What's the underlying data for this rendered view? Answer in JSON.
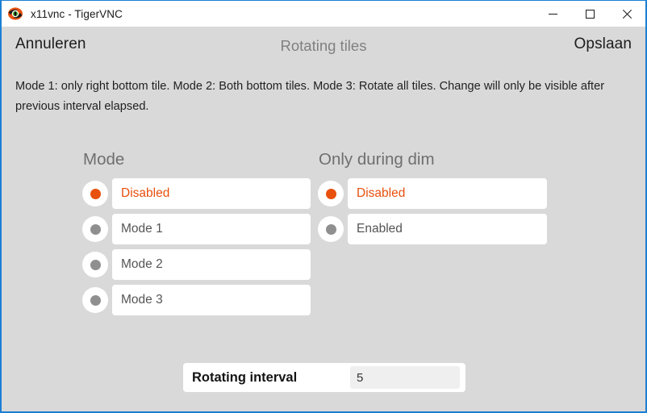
{
  "window": {
    "title": "x11vnc - TigerVNC",
    "app_icon": "tigervnc-icon",
    "border_color": "#1b7fd4",
    "background_color": "#d9d9d9",
    "controls": {
      "minimize": "minimize-icon",
      "maximize": "maximize-icon",
      "close": "close-icon"
    }
  },
  "topbar": {
    "cancel_label": "Annuleren",
    "screen_title": "Rotating tiles",
    "save_label": "Opslaan"
  },
  "description": "Mode 1: only right bottom tile. Mode 2: Both bottom tiles. Mode 3: Rotate all tiles. Change will only be visible after previous interval elapsed.",
  "accent_color": "#e8500e",
  "columns": [
    {
      "title": "Mode",
      "options": [
        {
          "label": "Disabled",
          "selected": true
        },
        {
          "label": "Mode 1",
          "selected": false
        },
        {
          "label": "Mode 2",
          "selected": false
        },
        {
          "label": "Mode 3",
          "selected": false
        }
      ]
    },
    {
      "title": "Only during dim",
      "options": [
        {
          "label": "Disabled",
          "selected": true
        },
        {
          "label": "Enabled",
          "selected": false
        }
      ]
    }
  ],
  "interval": {
    "label": "Rotating interval",
    "value": "5"
  }
}
